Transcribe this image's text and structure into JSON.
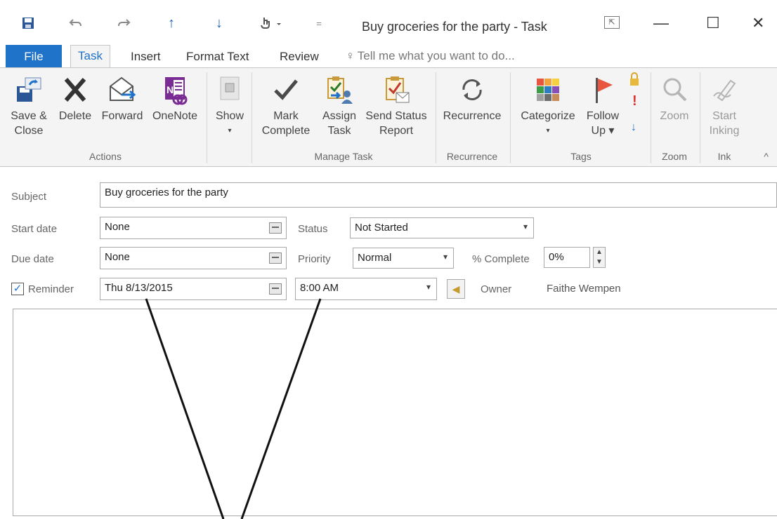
{
  "window": {
    "title": "Buy groceries for the party - Task",
    "qat": [
      "save-icon",
      "undo-icon",
      "redo-icon",
      "previous-item-icon",
      "next-item-icon",
      "touch-mode-icon",
      "customize-qat-icon"
    ],
    "window_controls": {
      "minimize": "—",
      "maximize": "☐",
      "close": "✕"
    }
  },
  "tabs": {
    "file": "File",
    "task": "Task",
    "insert": "Insert",
    "format_text": "Format Text",
    "review": "Review",
    "tell_me": "Tell me what you want to do..."
  },
  "ribbon": {
    "actions": {
      "save_close_1": "Save &",
      "save_close_2": "Close",
      "delete": "Delete",
      "forward": "Forward",
      "onenote": "OneNote",
      "label": "Actions"
    },
    "show": {
      "label": "Show",
      "arrow": "▾"
    },
    "manage_task": {
      "mark_1": "Mark",
      "mark_2": "Complete",
      "assign_1": "Assign",
      "assign_2": "Task",
      "send_1": "Send Status",
      "send_2": "Report",
      "label": "Manage Task"
    },
    "recurrence": {
      "button": "Recurrence",
      "label": "Recurrence"
    },
    "tags": {
      "categorize": "Categorize",
      "categorize_arrow": "▾",
      "follow_1": "Follow",
      "follow_2": "Up ▾",
      "label": "Tags"
    },
    "zoom": {
      "button": "Zoom",
      "label": "Zoom"
    },
    "ink": {
      "start_1": "Start",
      "start_2": "Inking",
      "label": "Ink"
    },
    "collapse": "^"
  },
  "form": {
    "subject_label": "Subject",
    "subject_value": "Buy groceries for the party",
    "start_label": "Start date",
    "start_value": "None",
    "due_label": "Due date",
    "due_value": "None",
    "reminder_label": "Reminder",
    "reminder_checked": true,
    "reminder_date": "Thu 8/13/2015",
    "reminder_time": "8:00 AM",
    "status_label": "Status",
    "status_value": "Not Started",
    "priority_label": "Priority",
    "priority_value": "Normal",
    "complete_label": "% Complete",
    "complete_value": "0%",
    "owner_label": "Owner",
    "owner_value": "Faithe Wempen"
  },
  "colors": {
    "accent": "#1f73c9",
    "ribbon_bg": "#f4f4f4",
    "flag_red": "#e8563f"
  }
}
